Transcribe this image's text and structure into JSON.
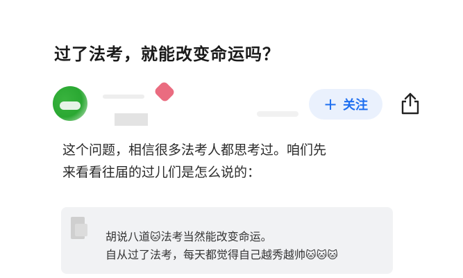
{
  "title": "过了法考，就能改变命运吗？",
  "author": {
    "follow_label": "关注",
    "follow_icon": "+"
  },
  "body": {
    "line1": "这个问题，相信很多法考人都思考过。咱们先",
    "line2": "来看看往届的过儿们是怎么说的："
  },
  "quote": {
    "line1_pre": "胡说八道",
    "line1_emoji": "🐱",
    "line1_post": "法考当然能改变命运。",
    "line2_text": "自从过了法考，每天都觉得自己越秀越帅",
    "line2_emojis": "🐱🐱🐱"
  },
  "colors": {
    "accent": "#1e6ff0",
    "follow_bg": "#eaf1fd",
    "quote_bg": "#f1f2f4"
  },
  "icons": [
    "share-icon",
    "plus-icon",
    "cat-emoji-icon"
  ]
}
